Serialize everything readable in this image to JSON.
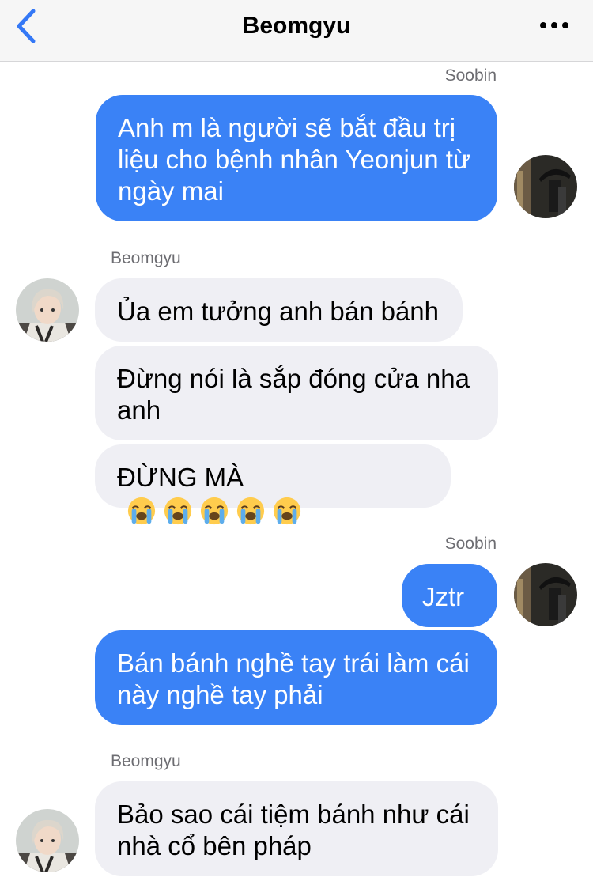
{
  "header": {
    "title": "Beomgyu"
  },
  "messages": [
    {
      "sender": "Soobin",
      "text": "Anh m là người sẽ bắt đầu trị liệu cho bệnh nhân Yeonjun từ ngày mai"
    },
    {
      "sender": "Beomgyu",
      "text": "Ủa em tưởng anh bán bánh"
    },
    {
      "text": "Đừng nói là sắp đóng cửa nha anh"
    },
    {
      "text": "ĐỪNG MÀ",
      "emoji": "loudly-crying-face",
      "emoji_count": 5
    },
    {
      "sender": "Soobin",
      "text": "Jztr"
    },
    {
      "text": "Bán bánh nghề tay trái làm cái này nghề tay phải"
    },
    {
      "sender": "Beomgyu",
      "text": "Bảo sao cái tiệm bánh như cái nhà cổ bên pháp"
    }
  ],
  "colors": {
    "outgoing_bubble": "#3a82f6",
    "incoming_bubble": "#efeff4",
    "accent": "#3478f6"
  },
  "icons": {
    "back": "chevron-left-icon",
    "more": "ellipsis-icon",
    "emoji": "loudly-crying-face-icon"
  }
}
